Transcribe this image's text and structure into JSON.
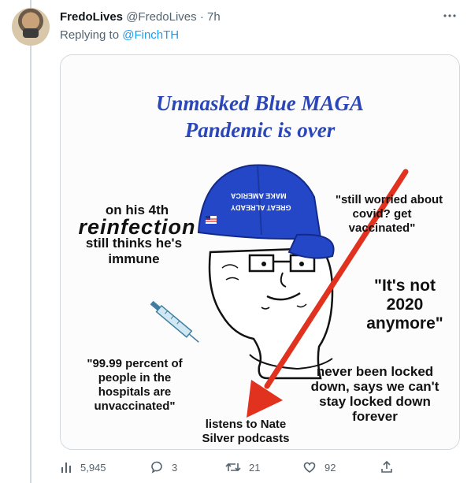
{
  "tweet": {
    "display_name": "FredoLives",
    "handle": "@FredoLives",
    "separator": "·",
    "age": "7h",
    "replying_prefix": "Replying to",
    "replying_to": "@FinchTH",
    "more_icon": "more-horizontal-icon"
  },
  "meme": {
    "title_line1": "Unmasked Blue MAGA",
    "title_line2": "Pandemic is over",
    "hat_line1": "MAKE AMERICA",
    "hat_line2": "GREAT ALREADY",
    "left_top_line1": "on his 4th",
    "left_top_line2": "reinfection",
    "left_top_line3": "still thinks he's",
    "left_top_line4": "immune",
    "right_top_line1": "\"still worried about",
    "right_top_line2": "covid? get",
    "right_top_line3": "vaccinated\"",
    "right_mid_line1": "\"It's not",
    "right_mid_line2": "2020",
    "right_mid_line3": "anymore\"",
    "left_bottom_line1": "\"99.99 percent of",
    "left_bottom_line2": "people in the",
    "left_bottom_line3": "hospitals are",
    "left_bottom_line4": "unvaccinated\"",
    "right_bottom_line1": "never been locked",
    "right_bottom_line2": "down, says we can't",
    "right_bottom_line3": "stay locked down",
    "right_bottom_line4": "forever",
    "bottom_line1": "listens to Nate",
    "bottom_line2": "Silver podcasts",
    "title_color": "#2a46b8",
    "arrow_color": "#e0321e",
    "hat_color": "#2447c7"
  },
  "actions": {
    "views": "5,945",
    "replies": "3",
    "retweets": "21",
    "likes": "92"
  }
}
